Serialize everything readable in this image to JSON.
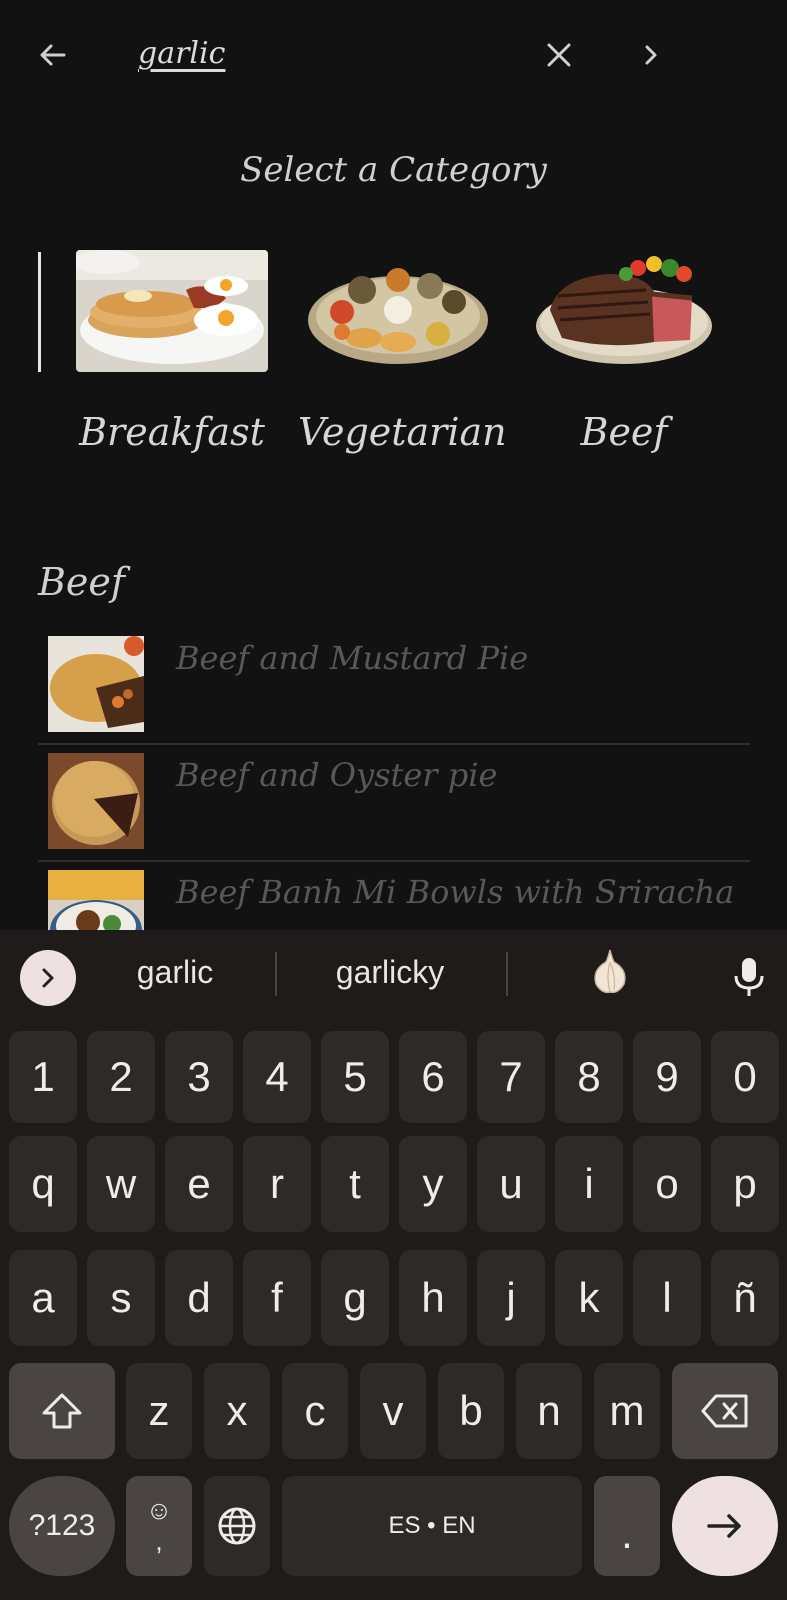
{
  "header": {
    "search_value": "garlic"
  },
  "categories_section": {
    "title": "Select a Category",
    "items": [
      {
        "label": "Breakfast"
      },
      {
        "label": "Vegetarian"
      },
      {
        "label": "Beef"
      }
    ]
  },
  "results": {
    "section_title": "Beef",
    "items": [
      {
        "title": "Beef and Mustard Pie"
      },
      {
        "title": "Beef and Oyster pie"
      },
      {
        "title": "Beef Banh Mi Bowls with Sriracha"
      }
    ]
  },
  "keyboard": {
    "suggestions": [
      "garlic",
      "garlicky"
    ],
    "emoji_suggestion": "garlic-emoji",
    "rows": [
      [
        "1",
        "2",
        "3",
        "4",
        "5",
        "6",
        "7",
        "8",
        "9",
        "0"
      ],
      [
        "q",
        "w",
        "e",
        "r",
        "t",
        "y",
        "u",
        "i",
        "o",
        "p"
      ],
      [
        "a",
        "s",
        "d",
        "f",
        "g",
        "h",
        "j",
        "k",
        "l",
        "ñ"
      ],
      [
        "z",
        "x",
        "c",
        "v",
        "b",
        "n",
        "m"
      ]
    ],
    "symbols_label": "?123",
    "comma_label": ",",
    "emoji_label": "☺",
    "space_label": "ES • EN",
    "period_label": ".",
    "colors": {
      "background": "#1f1b1b",
      "key": "#2f2a2a",
      "accent_key": "#efe1e1"
    }
  }
}
